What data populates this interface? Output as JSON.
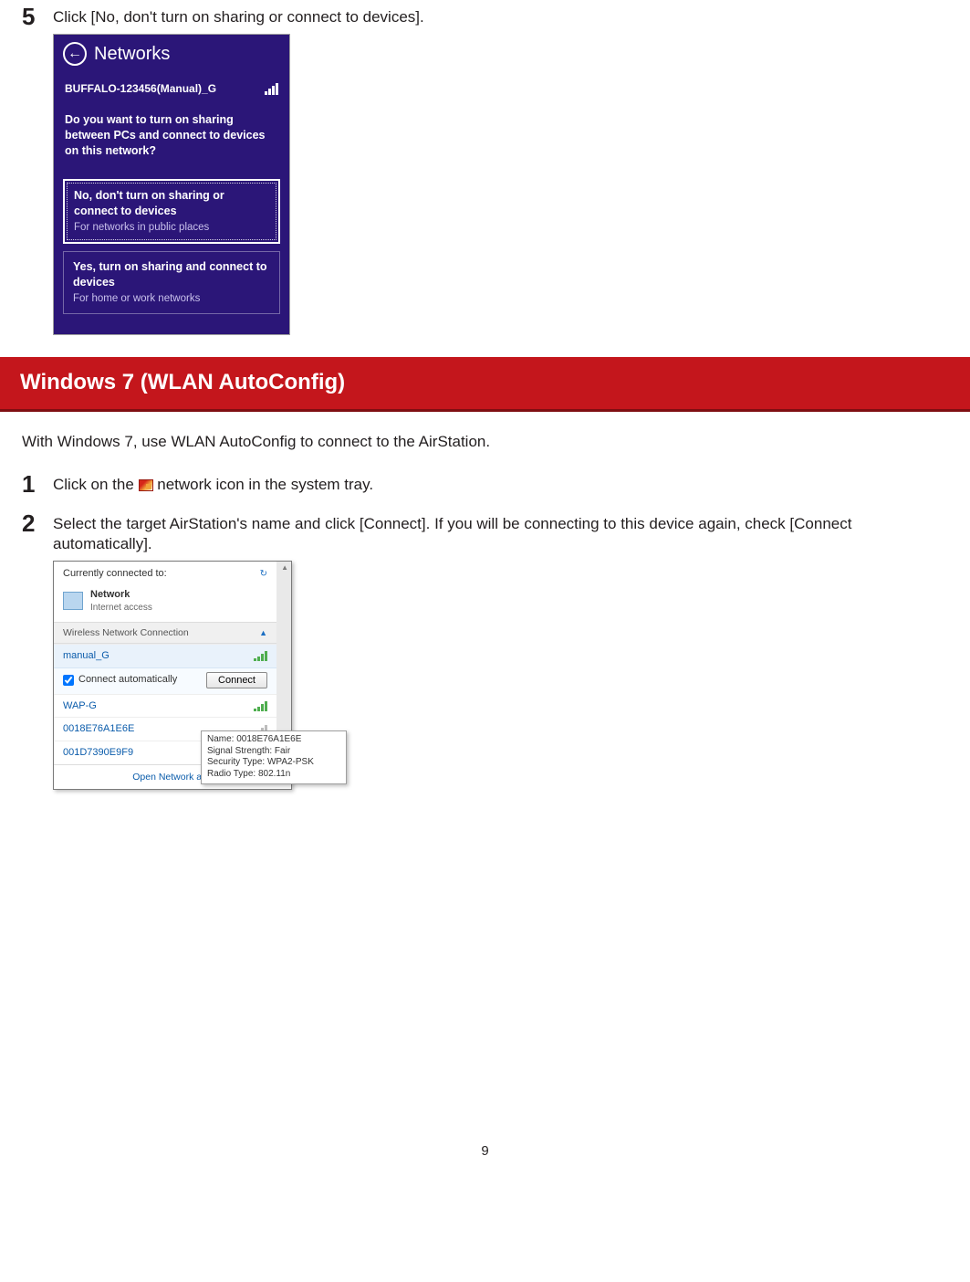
{
  "step5": {
    "num": "5",
    "text": "Click [No, don't turn on sharing or connect to devices]."
  },
  "w8": {
    "title": "Networks",
    "ssid": "BUFFALO-123456(Manual)_G",
    "question": "Do you want to turn on sharing between PCs and connect to devices on this network?",
    "opt_no_title": "No, don't turn on sharing or connect to devices",
    "opt_no_sub": "For networks in public places",
    "opt_yes_title": "Yes, turn on sharing and connect to devices",
    "opt_yes_sub": "For home or work networks"
  },
  "section_heading": "Windows 7 (WLAN AutoConfig)",
  "intro_text": "With Windows 7, use WLAN AutoConfig to connect to the AirStation.",
  "step1": {
    "num": "1",
    "pre": "Click on the ",
    "post": " network icon in the system tray."
  },
  "step2": {
    "num": "2",
    "text": "Select the target AirStation's name and click [Connect]. If you will be connecting to this device again, check [Connect automatically]."
  },
  "w7": {
    "currently": "Currently connected to:",
    "network_name": "Network",
    "network_sub": "Internet access",
    "wlan_heading": "Wireless Network Connection",
    "connect_auto": "Connect automatically",
    "connect_btn": "Connect",
    "footer": "Open Network and",
    "rows": {
      "r0": "manual_G",
      "r1": "WAP-G",
      "r2": "0018E76A1E6E",
      "r3": "001D7390E9F9"
    },
    "tooltip": {
      "l1": "Name: 0018E76A1E6E",
      "l2": "Signal Strength: Fair",
      "l3": "Security Type: WPA2-PSK",
      "l4": "Radio Type: 802.11n"
    }
  },
  "page_number": "9"
}
